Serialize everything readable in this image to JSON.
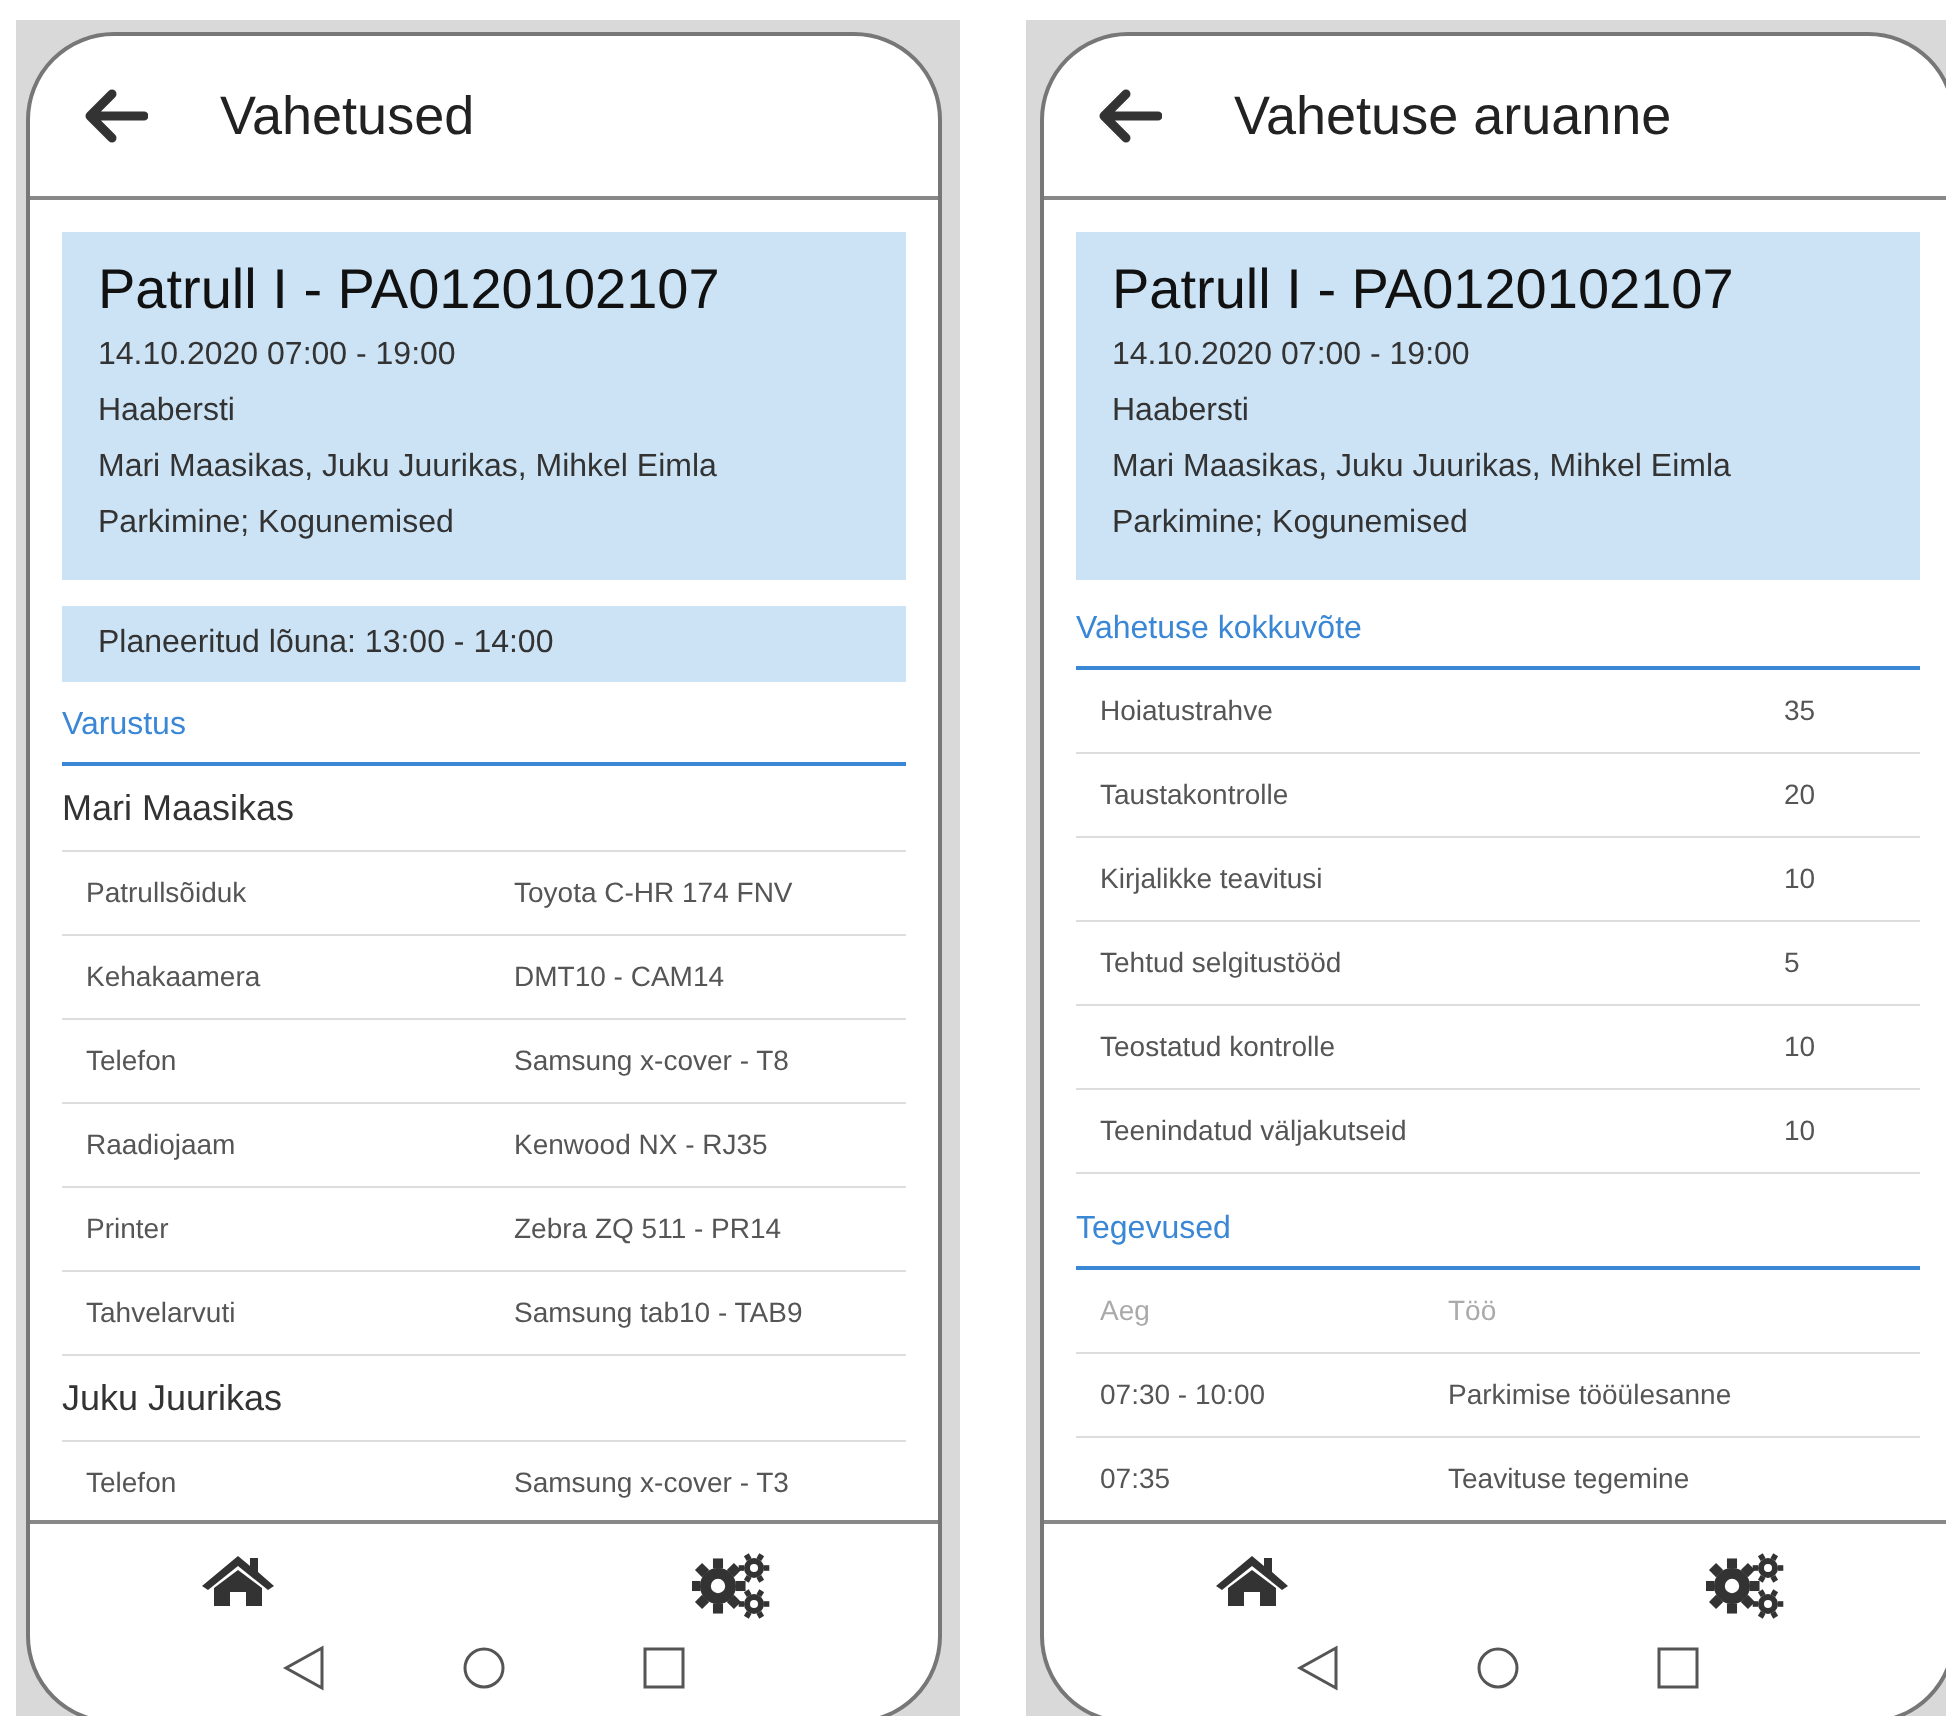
{
  "screens": [
    {
      "kind": "equipment",
      "title": "Vahetused",
      "card": {
        "title": "Patrull I - PA0120102107",
        "lines": [
          "14.10.2020 07:00 - 19:00",
          "Haabersti",
          "Mari Maasikas, Juku Juurikas, Mihkel Eimla",
          "Parkimine; Kogunemised"
        ]
      },
      "lunch": "Planeeritud lõuna: 13:00 - 14:00",
      "section_title": "Varustus",
      "groups": [
        {
          "name": "Mari Maasikas",
          "items": [
            {
              "label": "Patrullsõiduk",
              "value": "Toyota C-HR 174 FNV"
            },
            {
              "label": "Kehakaamera",
              "value": "DMT10 - CAM14"
            },
            {
              "label": "Telefon",
              "value": "Samsung x-cover - T8"
            },
            {
              "label": "Raadiojaam",
              "value": "Kenwood NX - RJ35"
            },
            {
              "label": "Printer",
              "value": "Zebra ZQ 511 - PR14"
            },
            {
              "label": "Tahvelarvuti",
              "value": "Samsung tab10 - TAB9"
            }
          ]
        },
        {
          "name": "Juku Juurikas",
          "items": [
            {
              "label": "Telefon",
              "value": "Samsung x-cover - T3"
            }
          ]
        }
      ]
    },
    {
      "kind": "report",
      "title": "Vahetuse aruanne",
      "card": {
        "title": "Patrull I - PA0120102107",
        "lines": [
          "14.10.2020 07:00 - 19:00",
          "Haabersti",
          "Mari Maasikas, Juku Juurikas, Mihkel Eimla",
          "Parkimine; Kogunemised"
        ]
      },
      "summary": {
        "title": "Vahetuse kokkuvõte",
        "rows": [
          {
            "label": "Hoiatustrahve",
            "value": "35"
          },
          {
            "label": "Taustakontrolle",
            "value": "20"
          },
          {
            "label": "Kirjalikke teavitusi",
            "value": "10"
          },
          {
            "label": "Tehtud selgitustööd",
            "value": "5"
          },
          {
            "label": "Teostatud kontrolle",
            "value": "10"
          },
          {
            "label": "Teenindatud väljakutseid",
            "value": "10"
          }
        ]
      },
      "activities": {
        "title": "Tegevused",
        "columns": [
          "Aeg",
          "Töö"
        ],
        "rows": [
          {
            "time": "07:30 - 10:00",
            "task": "Parkimise tööülesanne"
          },
          {
            "time": "07:35",
            "task": "Teavituse tegemine"
          }
        ]
      }
    }
  ]
}
